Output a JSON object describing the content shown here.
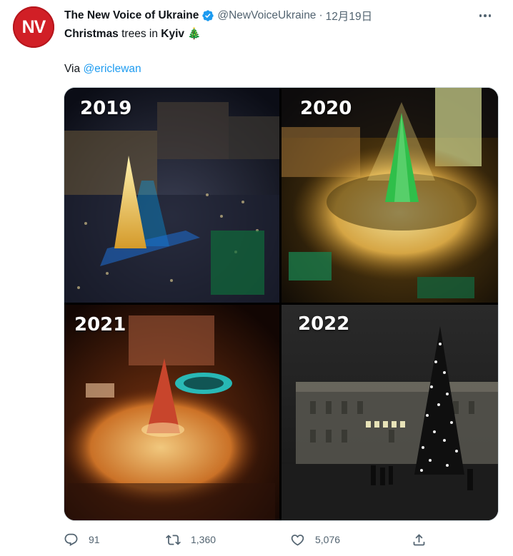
{
  "account": {
    "avatar_text": "NV",
    "avatar_color": "#d11f26",
    "name": "The New Voice of Ukraine",
    "handle": "@NewVoiceUkraine",
    "separator": "·",
    "time": "12月19日",
    "verified": true
  },
  "tweet": {
    "w1": "Christmas",
    "w2": " trees in ",
    "w3": "Kyiv",
    "emoji": "🎄",
    "via_prefix": "Via ",
    "via_link": "@ericlewan"
  },
  "media": {
    "years": [
      "2019",
      "2020",
      "2021",
      "2022"
    ]
  },
  "actions": {
    "reply_count": "91",
    "retweet_count": "1,360",
    "like_count": "5,076"
  },
  "colors": {
    "link": "#1d9bf0",
    "muted": "#536471",
    "verified": "#1d9bf0"
  }
}
